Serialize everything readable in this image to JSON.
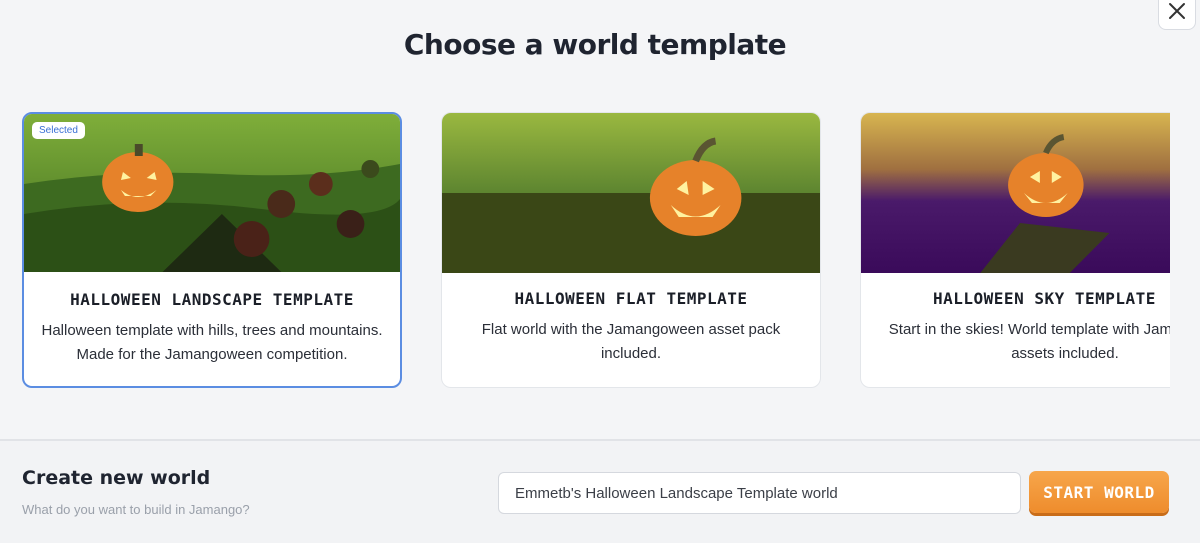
{
  "dialog": {
    "title": "Choose a world template",
    "close_icon": "close-icon"
  },
  "templates": [
    {
      "title": "HALLOWEEN LANDSCAPE TEMPLATE",
      "description": "Halloween template with hills, trees and mountains. Made for the Jamangoween competition.",
      "selected": true,
      "badge": "Selected"
    },
    {
      "title": "HALLOWEEN FLAT TEMPLATE",
      "description": "Flat world with the Jamangoween asset pack included.",
      "selected": false
    },
    {
      "title": "HALLOWEEN SKY TEMPLATE",
      "description": "Start in the skies! World template with Jamangoween assets included.",
      "selected": false
    }
  ],
  "create": {
    "title": "Create new world",
    "subtitle": "What do you want to build in Jamango?",
    "world_name_value": "Emmetb's Halloween Landscape Template world",
    "start_label": "START WORLD"
  },
  "colors": {
    "accent": "#5b8de2",
    "start_button": "#f29a3a"
  }
}
